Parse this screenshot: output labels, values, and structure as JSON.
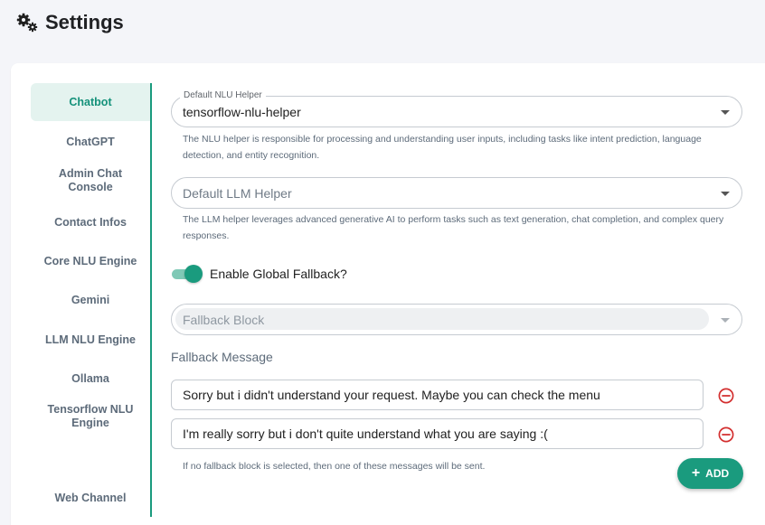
{
  "page": {
    "title": "Settings",
    "icon": "gears-icon"
  },
  "tabs": [
    {
      "label": "Chatbot",
      "active": true
    },
    {
      "label": "ChatGPT"
    },
    {
      "label": "Admin Chat Console"
    },
    {
      "label": "Contact Infos"
    },
    {
      "label": "Core NLU Engine"
    },
    {
      "label": "Gemini"
    },
    {
      "label": "LLM NLU Engine"
    },
    {
      "label": "Ollama"
    },
    {
      "label": "Tensorflow NLU Engine"
    },
    {
      "label": "Web Channel"
    }
  ],
  "nlu_helper": {
    "label": "Default NLU Helper",
    "value": "tensorflow-nlu-helper",
    "help": "The NLU helper is responsible for processing and understanding user inputs, including tasks like intent prediction, language detection, and entity recognition."
  },
  "llm_helper": {
    "placeholder": "Default LLM Helper",
    "help": "The LLM helper leverages advanced generative AI to perform tasks such as text generation, chat completion, and complex query responses."
  },
  "global_fallback": {
    "label": "Enable Global Fallback?",
    "enabled": true
  },
  "fallback_block": {
    "placeholder": "Fallback Block",
    "disabled": true
  },
  "fallback_message": {
    "label": "Fallback Message",
    "messages": [
      "Sorry but i didn't understand your request. Maybe you can check the menu",
      "I'm really sorry but i don't quite understand what you are saying :("
    ],
    "help": "If no fallback block is selected, then one of these messages will be sent.",
    "add_label": "ADD"
  },
  "colors": {
    "accent": "#1a9b7e",
    "accent_light": "#e4f3ef",
    "danger": "#d32f2f"
  }
}
